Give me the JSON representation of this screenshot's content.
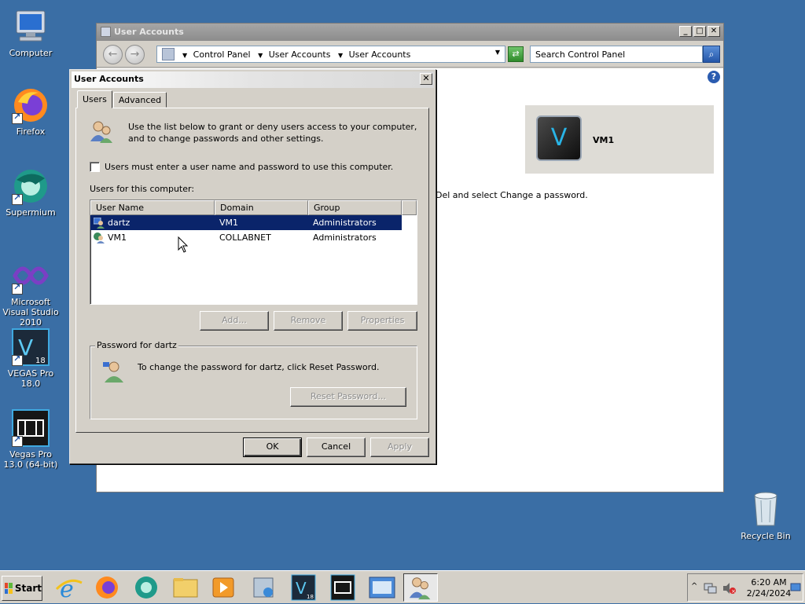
{
  "desktop": {
    "icons": [
      {
        "label": "Computer"
      },
      {
        "label": "Firefox"
      },
      {
        "label": "Supermium"
      },
      {
        "label": "Microsoft Visual Studio 2010"
      },
      {
        "label": "VEGAS Pro 18.0"
      },
      {
        "label": "Vegas Pro 13.0 (64-bit)"
      }
    ],
    "recycle_bin": "Recycle Bin"
  },
  "control_panel": {
    "title": "User Accounts",
    "breadcrumb": [
      "Control Panel",
      "User Accounts",
      "User Accounts"
    ],
    "search_placeholder": "Search Control Panel",
    "account_name": "VM1",
    "vm_letter": "V",
    "hint_text": "Del and select Change a password."
  },
  "dialog": {
    "title": "User Accounts",
    "tabs": [
      {
        "label": "Users"
      },
      {
        "label": "Advanced"
      }
    ],
    "intro": "Use the list below to grant or deny users access to your computer, and to change passwords and other settings.",
    "checkbox_label": "Users must enter a user name and password to use this computer.",
    "checkbox_checked": false,
    "users_label": "Users for this computer:",
    "columns": [
      "User Name",
      "Domain",
      "Group"
    ],
    "rows": [
      {
        "name": "dartz",
        "domain": "VM1",
        "group": "Administrators",
        "selected": true
      },
      {
        "name": "VM1",
        "domain": "COLLABNET",
        "group": "Administrators",
        "selected": false
      }
    ],
    "buttons": {
      "add": "Add...",
      "remove": "Remove",
      "properties": "Properties"
    },
    "password_group_title": "Password for dartz",
    "password_text": "To change the password for dartz, click Reset Password.",
    "reset_button": "Reset Password...",
    "ok": "OK",
    "cancel": "Cancel",
    "apply": "Apply"
  },
  "taskbar": {
    "start_label": "Start",
    "vegas_badge": "18",
    "clock_time": "6:20 AM",
    "clock_date": "2/24/2024"
  }
}
